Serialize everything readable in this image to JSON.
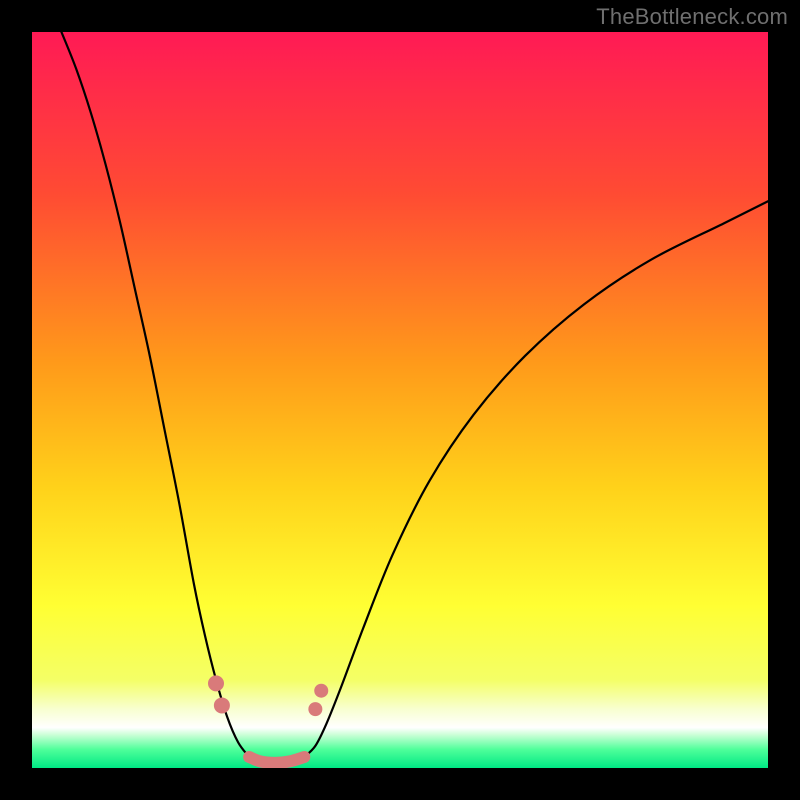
{
  "watermark": "TheBottleneck.com",
  "chart_data": {
    "type": "line",
    "title": "",
    "xlabel": "",
    "ylabel": "",
    "xlim": [
      0,
      100
    ],
    "ylim": [
      0,
      100
    ],
    "grid": false,
    "legend": false,
    "background_gradient_stops": [
      {
        "pos": 0.0,
        "color": "#ff1a55"
      },
      {
        "pos": 0.22,
        "color": "#ff4b33"
      },
      {
        "pos": 0.45,
        "color": "#ff9a1a"
      },
      {
        "pos": 0.62,
        "color": "#ffd21a"
      },
      {
        "pos": 0.78,
        "color": "#ffff33"
      },
      {
        "pos": 0.88,
        "color": "#f4ff66"
      },
      {
        "pos": 0.92,
        "color": "#f8ffd0"
      },
      {
        "pos": 0.945,
        "color": "#ffffff"
      },
      {
        "pos": 0.955,
        "color": "#caffd6"
      },
      {
        "pos": 0.975,
        "color": "#4eff9a"
      },
      {
        "pos": 1.0,
        "color": "#00e884"
      }
    ],
    "series": [
      {
        "name": "left-curve",
        "x": [
          4,
          6,
          8,
          10,
          12,
          14,
          16,
          18,
          20,
          22,
          23.5,
          25,
          26.5,
          28,
          29.5
        ],
        "y": [
          100,
          95,
          89,
          82,
          74,
          65,
          56,
          46,
          36,
          25,
          18,
          12,
          7,
          3.5,
          1.5
        ],
        "stroke": "#000000",
        "stroke_width": 2.2
      },
      {
        "name": "right-curve",
        "x": [
          37,
          38.5,
          40,
          42,
          45,
          49,
          54,
          60,
          67,
          75,
          84,
          94,
          100
        ],
        "y": [
          1.5,
          3,
          6,
          11,
          19,
          29,
          39,
          48,
          56,
          63,
          69,
          74,
          77
        ],
        "stroke": "#000000",
        "stroke_width": 2.2
      },
      {
        "name": "valley-floor",
        "x": [
          29.5,
          31,
          33,
          35,
          37
        ],
        "y": [
          1.5,
          0.9,
          0.7,
          0.9,
          1.5
        ],
        "stroke": "#d97a7a",
        "stroke_width": 12
      }
    ],
    "markers": [
      {
        "series": "left-curve",
        "x": 25.0,
        "y": 11.5,
        "r": 8,
        "color": "#d97a7a"
      },
      {
        "series": "left-curve",
        "x": 25.8,
        "y": 8.5,
        "r": 8,
        "color": "#d97a7a"
      },
      {
        "series": "right-curve",
        "x": 38.5,
        "y": 8.0,
        "r": 7,
        "color": "#d97a7a"
      },
      {
        "series": "right-curve",
        "x": 39.3,
        "y": 10.5,
        "r": 7,
        "color": "#d97a7a"
      }
    ]
  }
}
